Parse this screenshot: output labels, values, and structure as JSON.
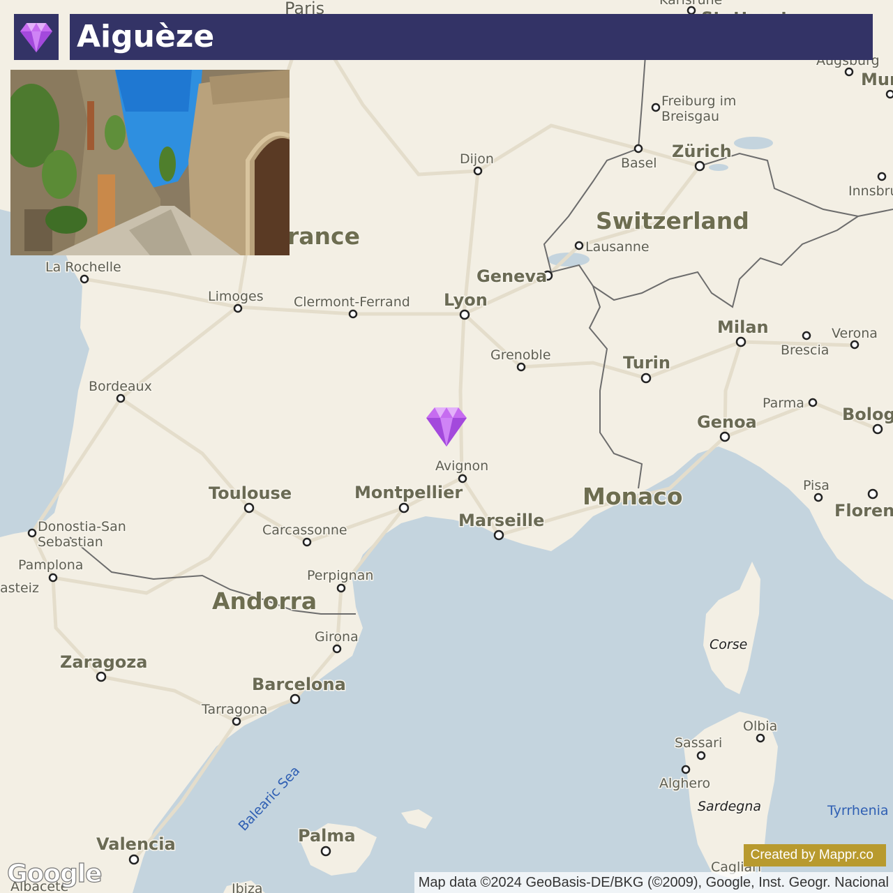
{
  "title": "Aiguèze",
  "credit": "Created by Mappr.co",
  "attribution": "Map data ©2024 GeoBasis-DE/BKG (©2009), Google, Inst. Geogr. Nacional",
  "logo": "Google",
  "colors": {
    "title_bar": "#333366",
    "water": "#c4d4de",
    "land": "#f3efe4",
    "credit_bg": "#b89a2e",
    "marker": "#c66cf0"
  },
  "marker": {
    "icon": "gem-icon",
    "name": "Aiguèze"
  },
  "photo": {
    "icon": "village-street-photo"
  },
  "places": {
    "paris": "Paris",
    "karlsruhe": "Karlsruhe",
    "stuttgart": "Stuttgart",
    "augsburg": "Augsburg",
    "munich": "Mun",
    "freiburg": "Freiburg im",
    "freiburg2": "Breisgau",
    "basel": "Basel",
    "zurich": "Zürich",
    "innsbruck": "Innsbru",
    "dijon": "Dijon",
    "lausanne": "Lausanne",
    "geneva": "Geneva",
    "lyon": "Lyon",
    "milan": "Milan",
    "verona": "Verona",
    "brescia": "Brescia",
    "turin": "Turin",
    "grenoble": "Grenoble",
    "parma": "Parma",
    "genoa": "Genoa",
    "bologna": "Bolog",
    "la_rochelle": "La Rochelle",
    "limoges": "Limoges",
    "clermont": "Clermont-Ferrand",
    "bordeaux": "Bordeaux",
    "avignon": "Avignon",
    "toulouse": "Toulouse",
    "montpellier": "Montpellier",
    "marseille": "Marseille",
    "pisa": "Pisa",
    "florence": "Floren",
    "donostia": "Donostia-San",
    "donostia2": "Sebastian",
    "carcassonne": "Carcassonne",
    "pamplona": "Pamplona",
    "vitoria": "asteiz",
    "perpignan": "Perpignan",
    "girona": "Girona",
    "zaragoza": "Zaragoza",
    "barcelona": "Barcelona",
    "tarragona": "Tarragona",
    "olbia": "Olbia",
    "sassari": "Sassari",
    "alghero": "Alghero",
    "valencia": "Valencia",
    "palma": "Palma",
    "cagliari": "Cagliari",
    "albacete": "Albacete",
    "ibiza": "Ibiza"
  },
  "countries": {
    "france": "rance",
    "switzerland": "Switzerland",
    "monaco": "Monaco",
    "andorra": "Andorra"
  },
  "islands": {
    "corse": "Corse",
    "sardegna": "Sardegna"
  },
  "seas": {
    "balearic": "Balearic Sea",
    "tyrrhenian": "Tyrrhenia"
  }
}
